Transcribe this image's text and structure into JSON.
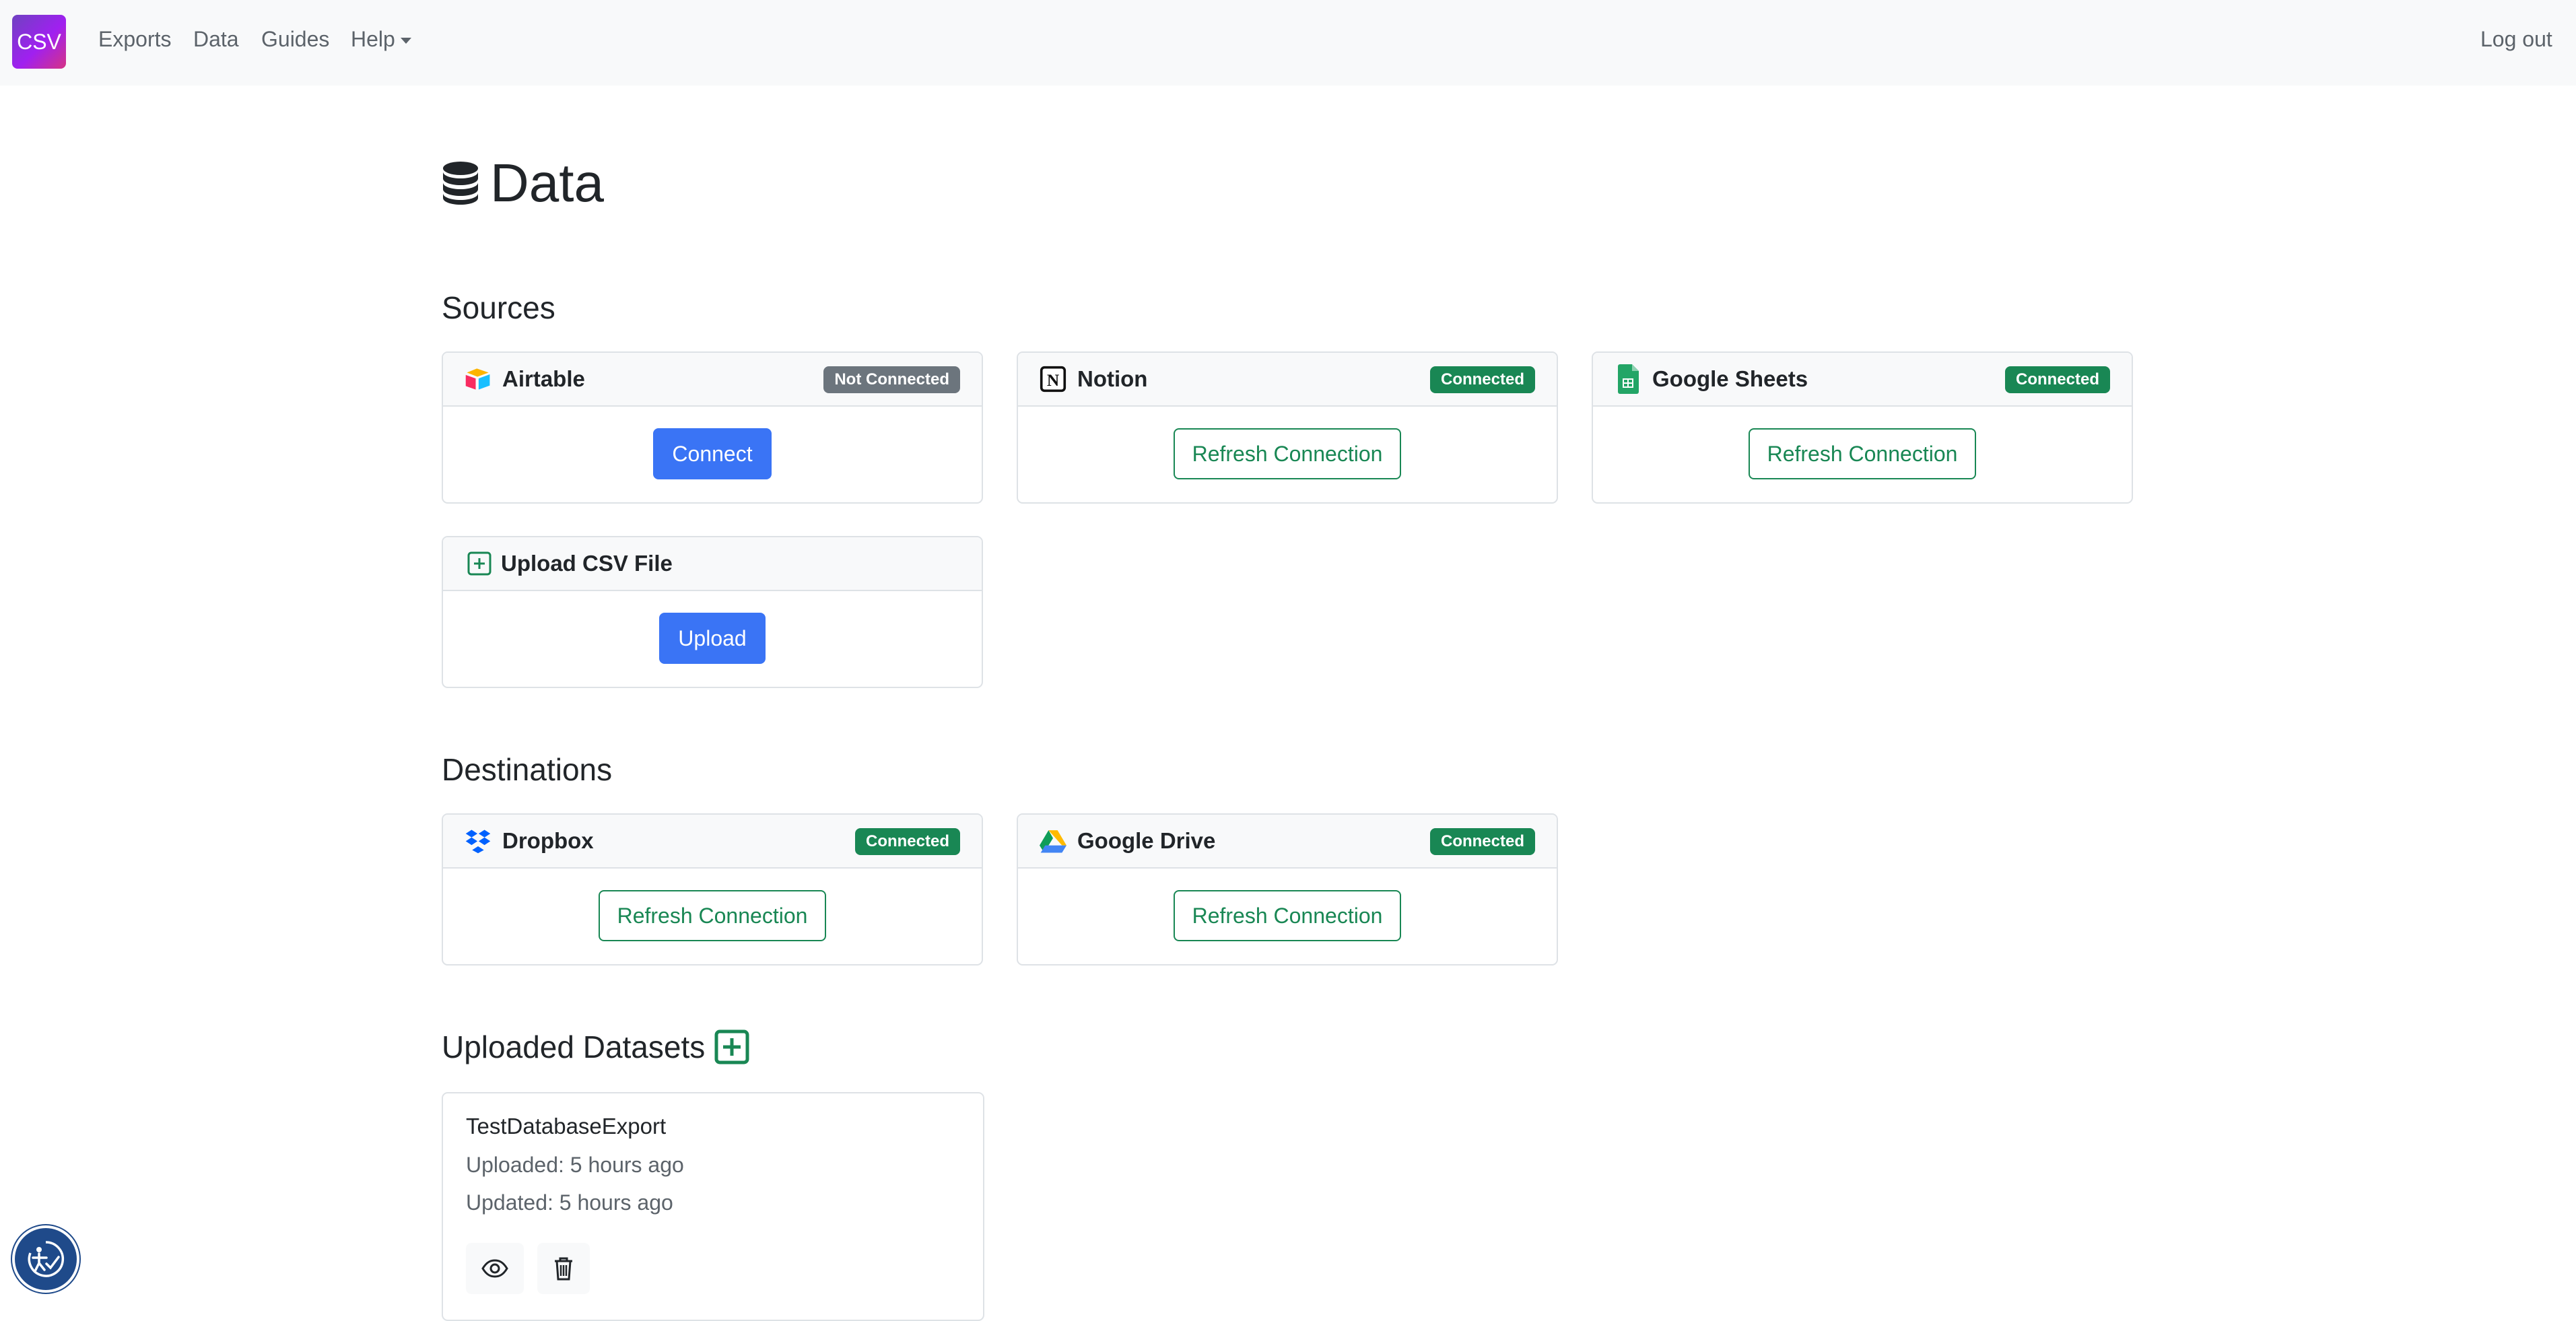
{
  "nav": {
    "brand": "CSV",
    "links": [
      "Exports",
      "Data",
      "Guides",
      "Help"
    ],
    "logout": "Log out"
  },
  "page": {
    "title": "Data",
    "title_icon": "database-icon"
  },
  "sources": {
    "heading": "Sources",
    "cards": [
      {
        "name": "Airtable",
        "icon": "airtable-icon",
        "status": "Not Connected",
        "button": "Connect"
      },
      {
        "name": "Notion",
        "icon": "notion-icon",
        "status": "Connected",
        "button": "Refresh Connection"
      },
      {
        "name": "Google Sheets",
        "icon": "google-sheets-icon",
        "status": "Connected",
        "button": "Refresh Connection"
      },
      {
        "name": "Upload CSV File",
        "icon": "plus-square-icon",
        "button": "Upload"
      }
    ]
  },
  "destinations": {
    "heading": "Destinations",
    "cards": [
      {
        "name": "Dropbox",
        "icon": "dropbox-icon",
        "status": "Connected",
        "button": "Refresh Connection"
      },
      {
        "name": "Google Drive",
        "icon": "google-drive-icon",
        "status": "Connected",
        "button": "Refresh Connection"
      }
    ]
  },
  "datasets": {
    "heading": "Uploaded Datasets",
    "items": [
      {
        "name": "TestDatabaseExport",
        "uploaded": "Uploaded: 5 hours ago",
        "updated": "Updated: 5 hours ago"
      }
    ]
  },
  "colors": {
    "primary": "#3a74f5",
    "success": "#198754",
    "secondary": "#6c757d",
    "navbar_bg": "#f8f9fa"
  }
}
